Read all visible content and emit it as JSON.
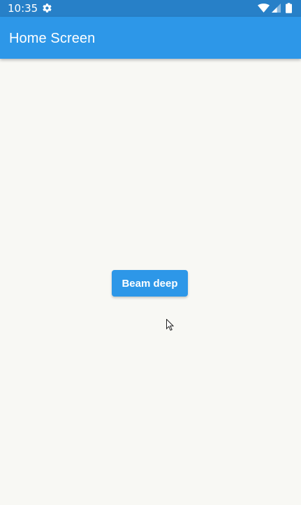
{
  "status_bar": {
    "time": "10:35",
    "icons": [
      "settings-icon",
      "wifi-icon",
      "signal-icon",
      "battery-icon"
    ]
  },
  "app_bar": {
    "title": "Home Screen"
  },
  "main": {
    "button_label": "Beam deep"
  },
  "colors": {
    "status_bar_bg": "#2780c8",
    "app_bar_bg": "#2d97e8",
    "button_bg": "#2d97e8",
    "page_bg": "#f8f8f4",
    "text_light": "#ffffff"
  }
}
